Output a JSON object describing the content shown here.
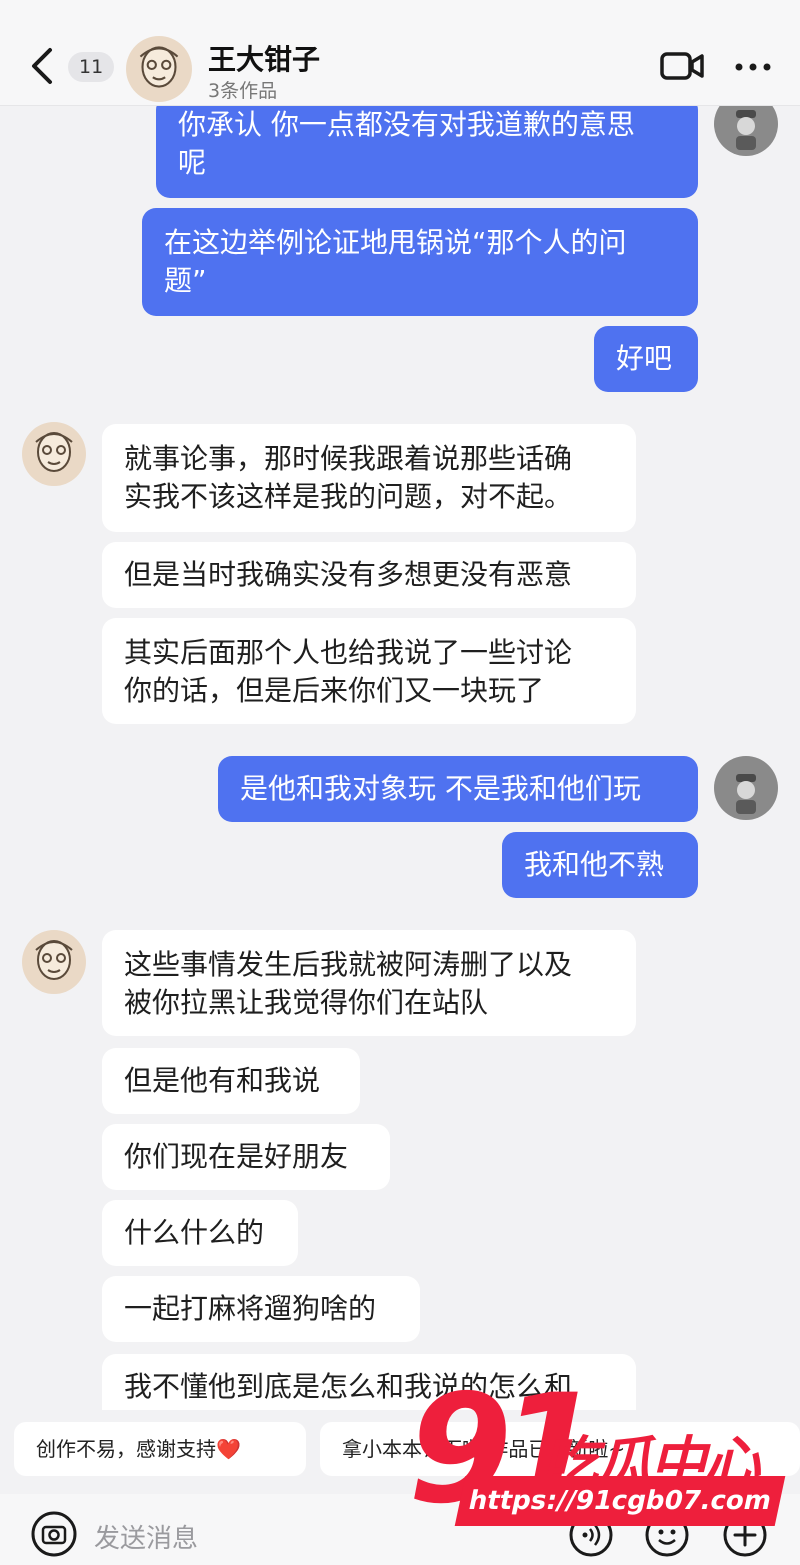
{
  "header": {
    "back_icon": "chevron-left-icon",
    "unread_count": "11",
    "contact_name": "王大钳子",
    "contact_sub": "3条作品",
    "video_icon": "video-camera-icon",
    "more_icon": "more-dots-icon"
  },
  "messages": [
    {
      "from": "me",
      "text": "你承认 你一点都没有对我道歉的意思\n呢"
    },
    {
      "from": "me",
      "text": "在这边举例论证地甩锅说“那个人的问\n题”"
    },
    {
      "from": "me",
      "text": "好吧"
    },
    {
      "from": "them",
      "text": "就事论事，那时候我跟着说那些话确\n实我不该这样是我的问题，对不起。"
    },
    {
      "from": "them",
      "text": "但是当时我确实没有多想更没有恶意"
    },
    {
      "from": "them",
      "text": "其实后面那个人也给我说了一些讨论\n你的话，但是后来你们又一块玩了"
    },
    {
      "from": "me",
      "text": "是他和我对象玩 不是我和他们玩"
    },
    {
      "from": "me",
      "text": "我和他不熟"
    },
    {
      "from": "them",
      "text": "这些事情发生后我就被阿涛删了以及\n被你拉黑让我觉得你们在站队"
    },
    {
      "from": "them",
      "text": "但是他有和我说"
    },
    {
      "from": "them",
      "text": "你们现在是好朋友"
    },
    {
      "from": "them",
      "text": "什么什么的"
    },
    {
      "from": "them",
      "text": "一起打麻将遛狗啥的"
    },
    {
      "from": "them",
      "text": "我不懂他到底是怎么和我说的怎么和"
    }
  ],
  "quick_replies": [
    "创作不易，感谢支持❤️",
    "拿小本本记下啦 作品已更新啦~"
  ],
  "input": {
    "placeholder": "发送消息"
  },
  "watermark": {
    "number": "91",
    "name": "吃瓜中心",
    "url": "https://91cgb07.com"
  },
  "colors": {
    "my_bubble": "#4f72f0",
    "their_bubble": "#ffffff",
    "background": "#f2f2f4",
    "watermark": "#ee1f3c"
  }
}
